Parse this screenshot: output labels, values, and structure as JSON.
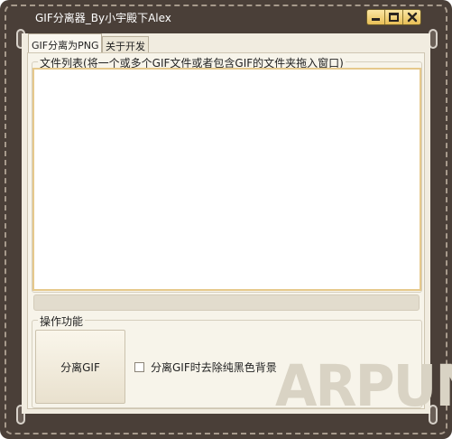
{
  "window": {
    "title": "GIF分离器_By小宇殿下Alex",
    "buttons": {
      "minimize": "minimize-icon",
      "maximize": "maximize-icon",
      "close": "close-icon"
    }
  },
  "tabs": [
    {
      "label": "GIF分离为PNG",
      "active": true
    },
    {
      "label": "关于开发",
      "active": false
    }
  ],
  "file_list": {
    "legend": "文件列表(将一个或多个GIF文件或者包含GIF的文件夹拖入窗口)",
    "items": []
  },
  "progress": {
    "value": 0
  },
  "operations": {
    "legend": "操作功能",
    "split_button": "分离GIF",
    "remove_black_bg": {
      "label": "分离GIF时去除纯黑色背景",
      "checked": false
    }
  },
  "watermark": "ARPUN",
  "colors": {
    "frame": "#4a3f38",
    "panel": "#f1ece0",
    "button_gold": "#e8bf56",
    "list_border": "#e6c98c"
  }
}
